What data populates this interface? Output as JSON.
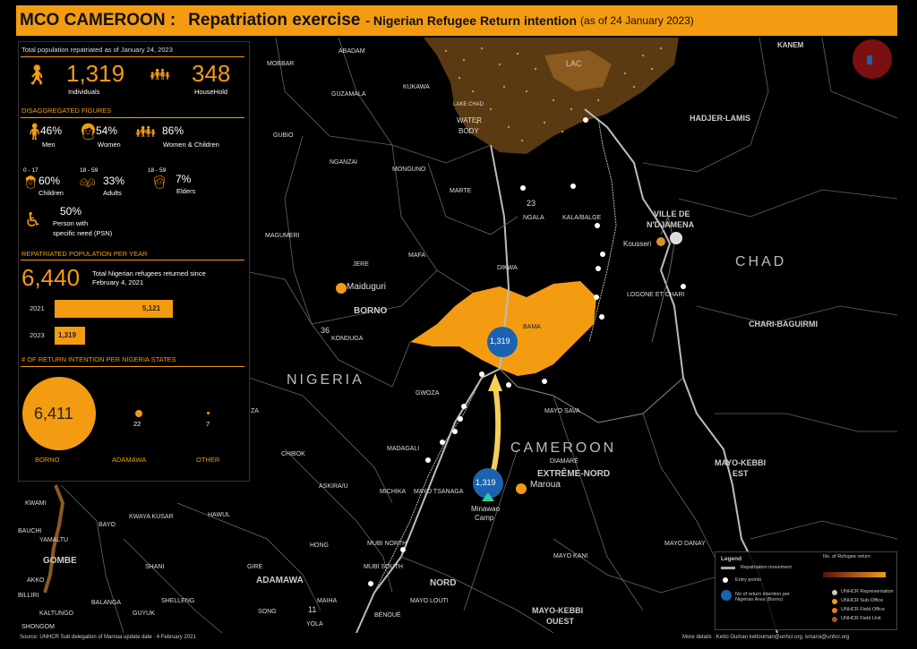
{
  "header": {
    "org": "MCO CAMEROON :",
    "title": "Repatriation exercise",
    "subtitle": "- Nigerian Refugee Return intention",
    "date": "(as of 24 January 2023)"
  },
  "panel": {
    "total_label": "Total population repatriated as of January 24, 2023",
    "individuals_value": "1,319",
    "individuals_label": "Individuals",
    "households_value": "348",
    "households_label": "HouseHold",
    "disaggregated_title": "DISAGGREGATED FIGURES",
    "men_pct": "46%",
    "men_label": "Men",
    "women_pct": "54%",
    "women_label": "Women",
    "wc_pct": "86%",
    "wc_label": "Women & Children",
    "children_range": "0 - 17",
    "children_pct": "60%",
    "children_label": "Children",
    "adults_range": "18 - 59",
    "adults_pct": "33%",
    "adults_label": "Adults",
    "elders_range": "18 - 59",
    "elders_pct": "7%",
    "elders_label": "Elders",
    "psn_pct": "50%",
    "psn_label1": "Person with",
    "psn_label2": "specific need (PSN)",
    "per_year_title": "REPATRIATED POPULATION PER YEAR",
    "total_returned": "6,440",
    "total_returned_label1": "Total Nigerian refugees returned since",
    "total_returned_label2": "February 4, 2021",
    "bars": [
      {
        "year": "2021",
        "value": 5121,
        "label": "5,121"
      },
      {
        "year": "2023",
        "value": 1319,
        "label": "1,319"
      }
    ],
    "intention_title": "# OF RETURN INTENTION PER NIGERIA STATES",
    "states": [
      {
        "name": "BORNO",
        "value": "6,411"
      },
      {
        "name": "ADAMAWA",
        "value": "22"
      },
      {
        "name": "OTHER",
        "value": "7"
      }
    ]
  },
  "map": {
    "countries": {
      "nigeria": "NIGERIA",
      "cameroon": "CAMEROON",
      "chad": "CHAD"
    },
    "regions": {
      "borno": "BORNO",
      "adamawa": "ADAMAWA",
      "gombe": "GOMBE",
      "extreme_nord": "EXTRÊME-NORD",
      "nord": "NORD",
      "hadjer_lamis": "HADJER-LAMIS",
      "chari_baguirmi": "CHARI-BAGUIRMI",
      "mayo_kebbi_est1": "MAYO-KEBBI",
      "mayo_kebbi_est2": "EST",
      "mayo_kebbi_ouest1": "MAYO-KEBBI",
      "mayo_kebbi_ouest2": "OUEST",
      "ndjamena1": "VILLE DE",
      "ndjamena2": "N'DJAMENA",
      "kanem": "KANEM",
      "lac": "LAC",
      "lake1": "LAKE CHAD",
      "lake2": "WATER",
      "lake3": "BODY"
    },
    "lgas": [
      "MOBBAR",
      "ABADAM",
      "GUZAMALA",
      "KUKAWA",
      "GUBIO",
      "NGANZAI",
      "MONGUNO",
      "MAGUMERI",
      "MARTE",
      "NGALA",
      "KALA/BALGE",
      "JERE",
      "MAFA",
      "DIKWA",
      "KONDUGA",
      "BAMA",
      "GWOZA",
      "MAYO SAVA",
      "MADAGALI",
      "CHIBOK",
      "ASKIRA/U",
      "MICHIKA",
      "MAYO TSANAGA",
      "DIAMARÉ",
      "KWAMI",
      "BAUCHI",
      "YAMALTU",
      "BAYO",
      "KWAYA KUSAR",
      "HAWUL",
      "AKKO",
      "BILLIRI",
      "KALTUNGO",
      "SHONGOM",
      "SHANI",
      "BALANGA",
      "SHELLENG",
      "GUYUK",
      "HONG",
      "GIRE",
      "MUBI NORTH",
      "MUBI SOUTH",
      "MAIHA",
      "SONG",
      "YOLA",
      "BÉNOUÉ",
      "MAYO LOUTI",
      "MAYO KANI",
      "MAYO DANAY",
      "LOGONE ET CHARI",
      "ZA"
    ],
    "towns": {
      "maiduguri": "Maiduguri",
      "maroua": "Maroua",
      "kousseri": "Kousseri",
      "minawao1": "Minawao",
      "minawao2": "Camp"
    },
    "numbers": {
      "n23": "23",
      "n36": "36",
      "n11": "11"
    },
    "bubbles": {
      "borno_dest": "1,319",
      "minawao": "1,319"
    }
  },
  "legend": {
    "title": "Legend",
    "items": [
      "Repatriation movement",
      "Entry points",
      "No of return intention per Nigerian Area (Borno)",
      "UNHCR Representation",
      "UNHCR Sub-Office",
      "UNHCR Field Office",
      "UNHCR Field Unit"
    ],
    "scale_title": "No. of Refugee return"
  },
  "footer": {
    "left": "Source: UNHCR Sub delegation of Maroua    update date : 4 February 2021",
    "right": "More details :  Ketto Ouman  kettouman@unhcr.org, kmaroi@unhcr.org"
  },
  "colors": {
    "accent": "#f39c12",
    "lake": "#5a3a12",
    "highlight": "#f39c12",
    "bubble": "#1a63b0"
  }
}
